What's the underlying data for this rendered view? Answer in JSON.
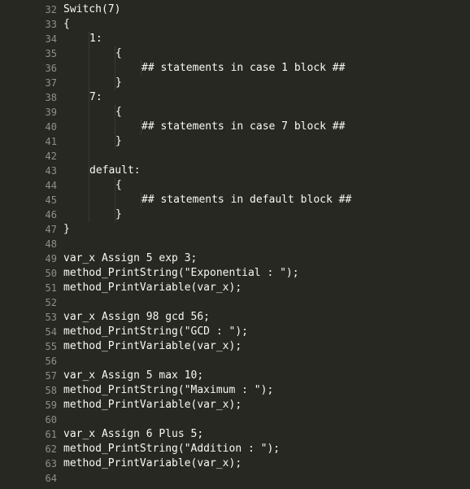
{
  "editor": {
    "lines": [
      {
        "num": "32",
        "indent": 0,
        "text": "Switch(7)"
      },
      {
        "num": "33",
        "indent": 0,
        "text": "{"
      },
      {
        "num": "34",
        "indent": 1,
        "text": "1:"
      },
      {
        "num": "35",
        "indent": 2,
        "text": "{"
      },
      {
        "num": "36",
        "indent": 3,
        "text": "## statements in case 1 block ##"
      },
      {
        "num": "37",
        "indent": 2,
        "text": "}"
      },
      {
        "num": "38",
        "indent": 1,
        "text": "7:"
      },
      {
        "num": "39",
        "indent": 2,
        "text": "{"
      },
      {
        "num": "40",
        "indent": 3,
        "text": "## statements in case 7 block ##"
      },
      {
        "num": "41",
        "indent": 2,
        "text": "}"
      },
      {
        "num": "42",
        "indent": 0,
        "text": ""
      },
      {
        "num": "43",
        "indent": 1,
        "text": "default:"
      },
      {
        "num": "44",
        "indent": 2,
        "text": "{"
      },
      {
        "num": "45",
        "indent": 3,
        "text": "## statements in default block ##"
      },
      {
        "num": "46",
        "indent": 2,
        "text": "}"
      },
      {
        "num": "47",
        "indent": 0,
        "text": "}"
      },
      {
        "num": "48",
        "indent": 0,
        "text": ""
      },
      {
        "num": "49",
        "indent": 0,
        "text": "var_x Assign 5 exp 3;"
      },
      {
        "num": "50",
        "indent": 0,
        "text": "method_PrintString(\"Exponential : \");"
      },
      {
        "num": "51",
        "indent": 0,
        "text": "method_PrintVariable(var_x);"
      },
      {
        "num": "52",
        "indent": 0,
        "text": ""
      },
      {
        "num": "53",
        "indent": 0,
        "text": "var_x Assign 98 gcd 56;"
      },
      {
        "num": "54",
        "indent": 0,
        "text": "method_PrintString(\"GCD : \");"
      },
      {
        "num": "55",
        "indent": 0,
        "text": "method_PrintVariable(var_x);"
      },
      {
        "num": "56",
        "indent": 0,
        "text": ""
      },
      {
        "num": "57",
        "indent": 0,
        "text": "var_x Assign 5 max 10;"
      },
      {
        "num": "58",
        "indent": 0,
        "text": "method_PrintString(\"Maximum : \");"
      },
      {
        "num": "59",
        "indent": 0,
        "text": "method_PrintVariable(var_x);"
      },
      {
        "num": "60",
        "indent": 0,
        "text": ""
      },
      {
        "num": "61",
        "indent": 0,
        "text": "var_x Assign 6 Plus 5;"
      },
      {
        "num": "62",
        "indent": 0,
        "text": "method_PrintString(\"Addition : \");"
      },
      {
        "num": "63",
        "indent": 0,
        "text": "method_PrintVariable(var_x);"
      },
      {
        "num": "64",
        "indent": 0,
        "text": ""
      }
    ]
  }
}
